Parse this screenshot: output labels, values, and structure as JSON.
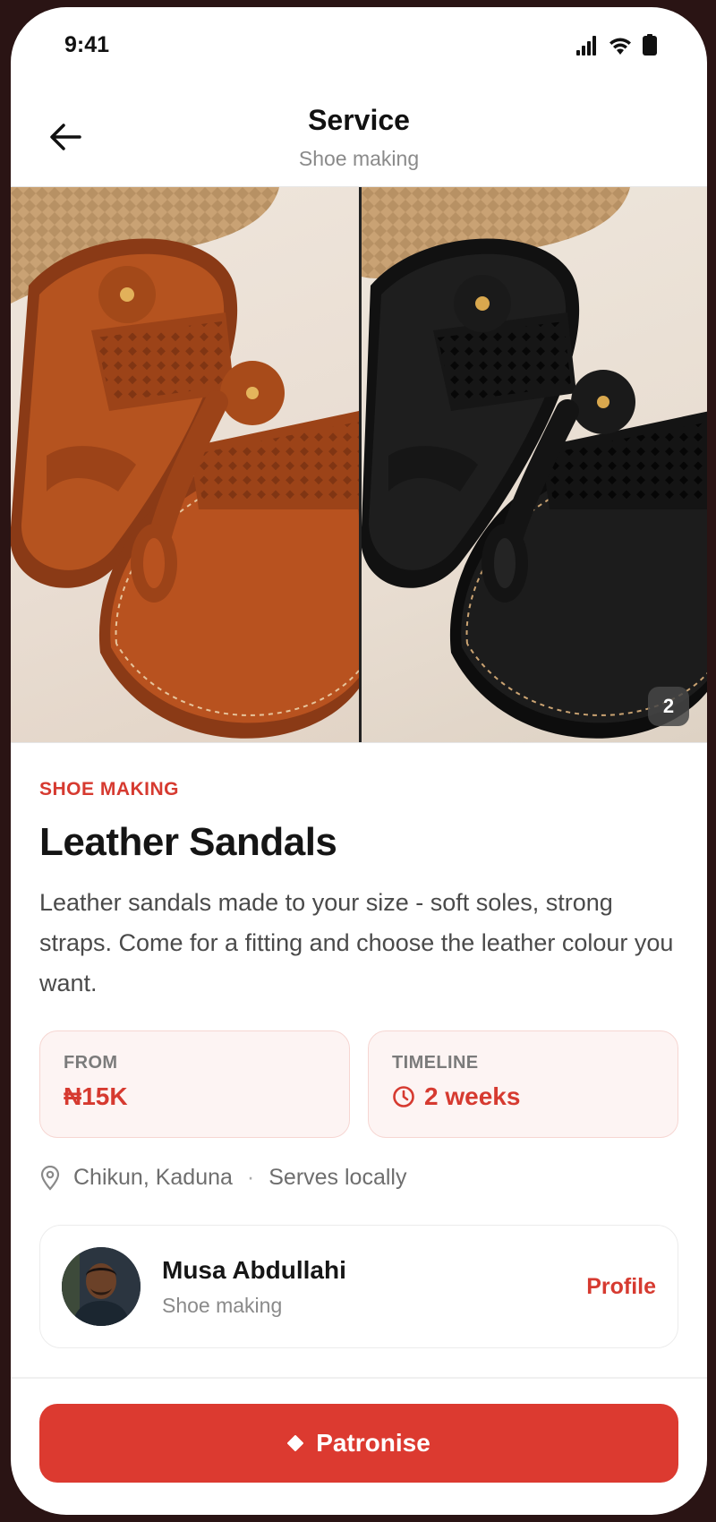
{
  "status_bar": {
    "time": "9:41"
  },
  "header": {
    "title": "Service",
    "subtitle": "Shoe making"
  },
  "gallery": {
    "image_count": "2"
  },
  "service": {
    "category": "SHOE MAKING",
    "title": "Leather Sandals",
    "description": "Leather sandals made to your size - soft soles, strong straps. Come for a fitting and choose the leather colour you want."
  },
  "pricing": {
    "from_label": "FROM",
    "from_value": "₦15K",
    "timeline_label": "TIMELINE",
    "timeline_value": "2 weeks"
  },
  "location": {
    "place": "Chikun, Kaduna",
    "separator": "·",
    "coverage": "Serves locally"
  },
  "artisan": {
    "name": "Musa Abdullahi",
    "role": "Shoe making",
    "profile_label": "Profile"
  },
  "actions": {
    "patronise_label": "Patronise"
  },
  "colors": {
    "accent": "#dc3a30",
    "accent_text": "#d63a30",
    "card_bg": "#fdf4f3"
  }
}
